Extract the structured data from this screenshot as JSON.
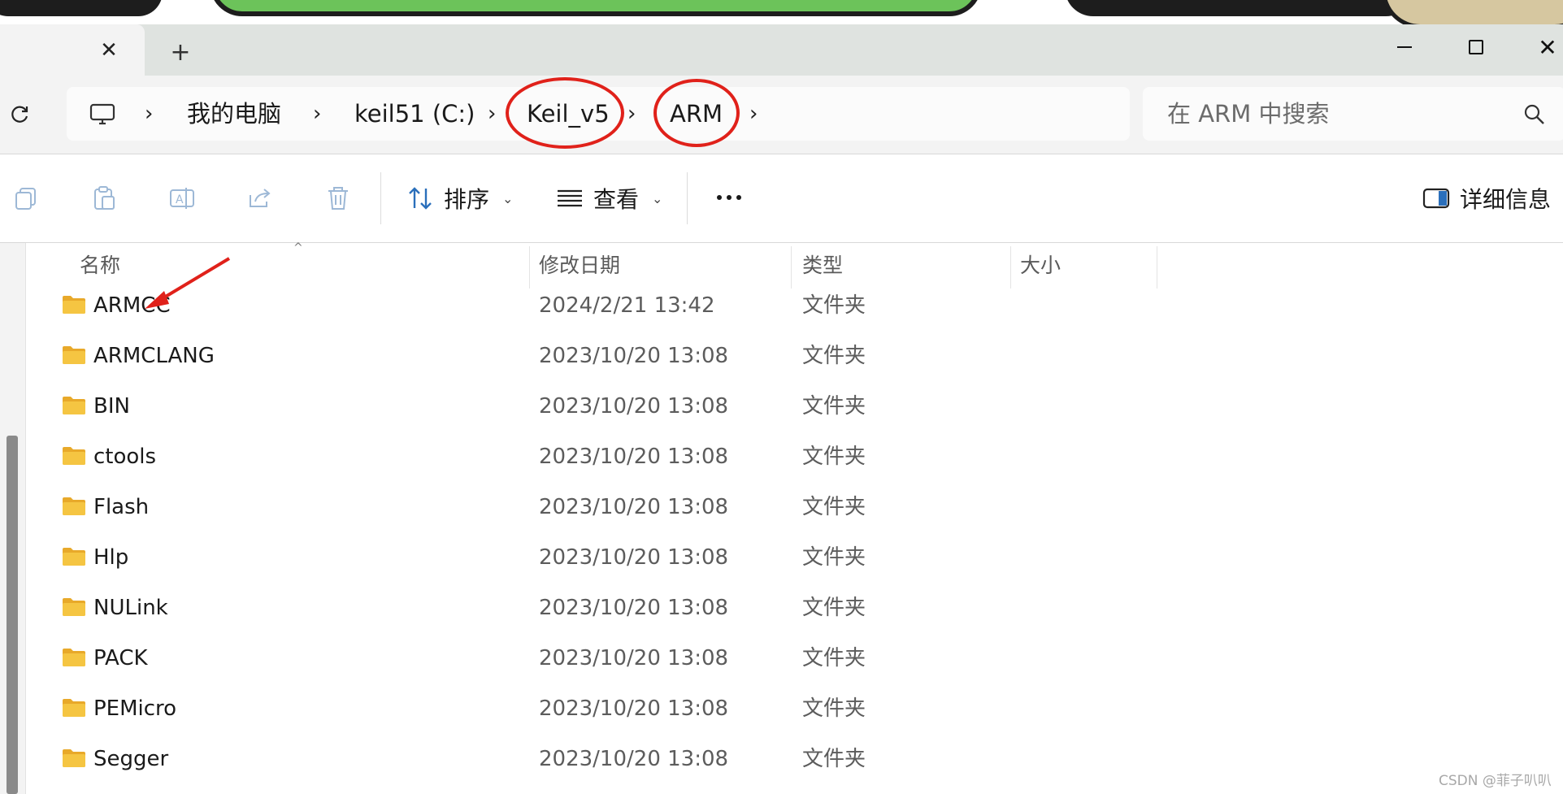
{
  "tab": {
    "close_glyph": "✕",
    "new_tab_glyph": "+"
  },
  "window_controls": {
    "minimize": "minimize-icon",
    "maximize": "maximize-icon",
    "close": "✕"
  },
  "breadcrumb": {
    "items": [
      "我的电脑",
      "keil51 (C:)",
      "Keil_v5",
      "ARM"
    ],
    "separator": "›"
  },
  "search": {
    "placeholder": "在 ARM 中搜索"
  },
  "toolbar": {
    "sort_label": "排序",
    "view_label": "查看",
    "details_label": "详细信息"
  },
  "columns": {
    "name": "名称",
    "modified": "修改日期",
    "type": "类型",
    "size": "大小"
  },
  "files": [
    {
      "name": "ARMCC",
      "modified": "2024/2/21 13:42",
      "type": "文件夹"
    },
    {
      "name": "ARMCLANG",
      "modified": "2023/10/20 13:08",
      "type": "文件夹"
    },
    {
      "name": "BIN",
      "modified": "2023/10/20 13:08",
      "type": "文件夹"
    },
    {
      "name": "ctools",
      "modified": "2023/10/20 13:08",
      "type": "文件夹"
    },
    {
      "name": "Flash",
      "modified": "2023/10/20 13:08",
      "type": "文件夹"
    },
    {
      "name": "Hlp",
      "modified": "2023/10/20 13:08",
      "type": "文件夹"
    },
    {
      "name": "NULink",
      "modified": "2023/10/20 13:08",
      "type": "文件夹"
    },
    {
      "name": "PACK",
      "modified": "2023/10/20 13:08",
      "type": "文件夹"
    },
    {
      "name": "PEMicro",
      "modified": "2023/10/20 13:08",
      "type": "文件夹"
    },
    {
      "name": "Segger",
      "modified": "2023/10/20 13:08",
      "type": "文件夹"
    }
  ],
  "annotations": {
    "highlight_color": "#e0211a"
  },
  "watermark": "CSDN @菲子叭叭",
  "colors": {
    "folder": "#f5c542",
    "folder_dark": "#e8a92a",
    "titlebar": "#dfe3e0"
  }
}
